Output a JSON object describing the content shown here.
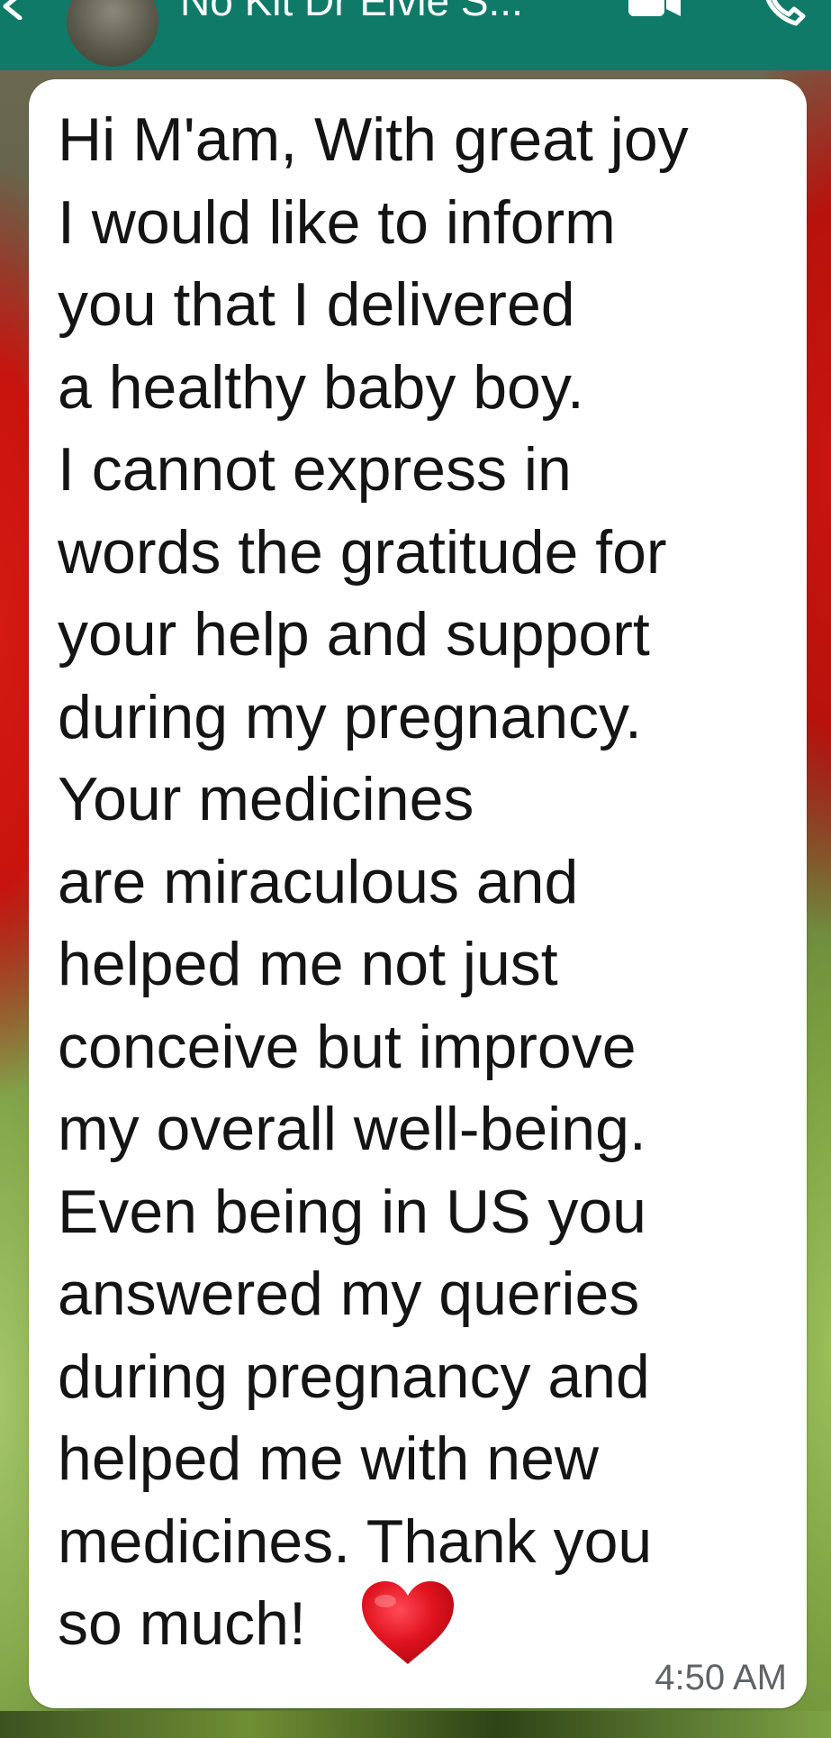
{
  "header": {
    "contact_name": "No Kit Dr Elvie S...",
    "back_icon": "arrow-left-icon",
    "video_icon": "video-camera-icon",
    "call_icon": "phone-icon",
    "bar_color": "#0f7a68"
  },
  "message": {
    "text": "Hi M'am, With great joy\nI would like to inform\nyou that I delivered\na healthy baby boy.\nI cannot express in\nwords the gratitude for\nyour help and support\nduring my pregnancy.\nYour medicines\nare miraculous and\nhelped me not just\nconceive but improve\nmy overall well-being.\nEven being in US you\nanswered my queries\nduring pregnancy and\nhelped me with new\nmedicines. Thank you\nso much!",
    "emoji": "red-heart-icon",
    "time": "4:50 AM",
    "bubble_color": "#ffffff"
  }
}
